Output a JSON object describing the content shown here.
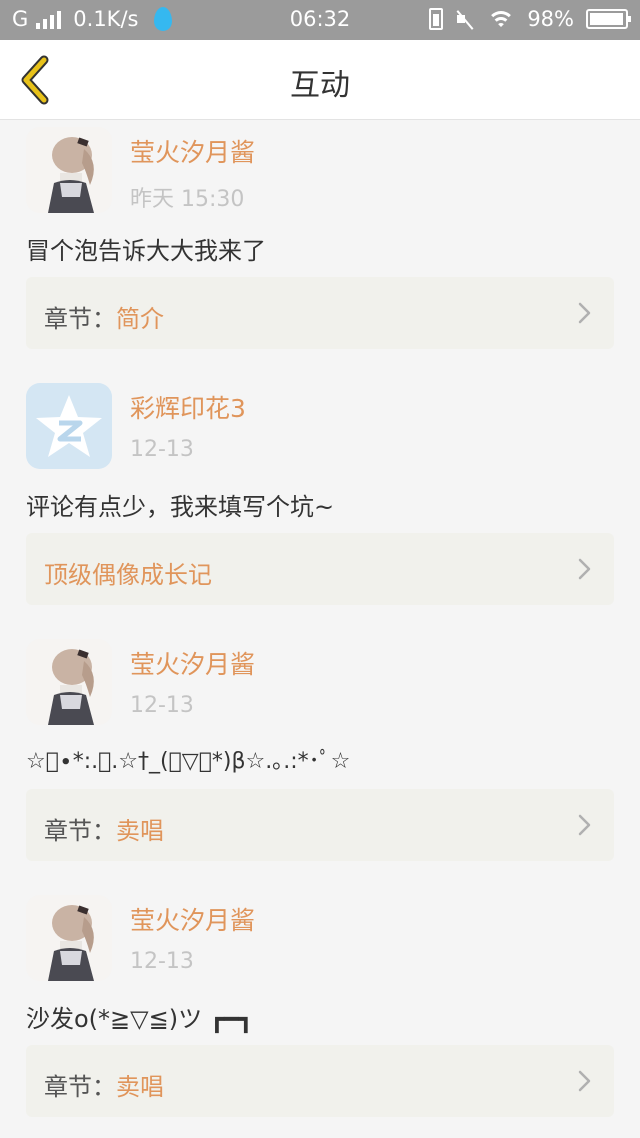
{
  "status_bar": {
    "network": "G",
    "speed": "0.1K/s",
    "time": "06:32",
    "battery": "98%",
    "battery_level": 0.98
  },
  "header": {
    "title": "互动"
  },
  "comments": [
    {
      "user": "莹火汐月酱",
      "time": "昨天 15:30",
      "text": "冒个泡告诉大大我来了",
      "chapter_prefix": "章节：",
      "chapter": "简介"
    },
    {
      "user": "彩辉印花3",
      "time": "12-13",
      "text": "评论有点少，我来填写个坑~",
      "chapter_prefix": "",
      "chapter": "顶级偶像成长记"
    },
    {
      "user": "莹火汐月酱",
      "time": "12-13",
      "text": "☆ﾟ∙*:.｡.☆†_(ﾟ▽ﾟ*)β☆.｡.:*･ﾟ☆",
      "chapter_prefix": "章节：",
      "chapter": "卖唱"
    },
    {
      "user": "莹火汐月酱",
      "time": "12-13",
      "text": "沙发o(*≧▽≦)ツ ┏━┓",
      "chapter_prefix": "章节：",
      "chapter": "卖唱"
    }
  ],
  "icons": {
    "back": "chevron-left-icon",
    "chapter_arrow": "chevron-right-icon",
    "qq_avatar": "qq-zone-star-icon"
  },
  "colors": {
    "status_bar": "#9b9b9b",
    "accent_orange": "#e0955b",
    "back_arrow": "#e8c21a",
    "chapter_bg": "#f1f1ec"
  }
}
